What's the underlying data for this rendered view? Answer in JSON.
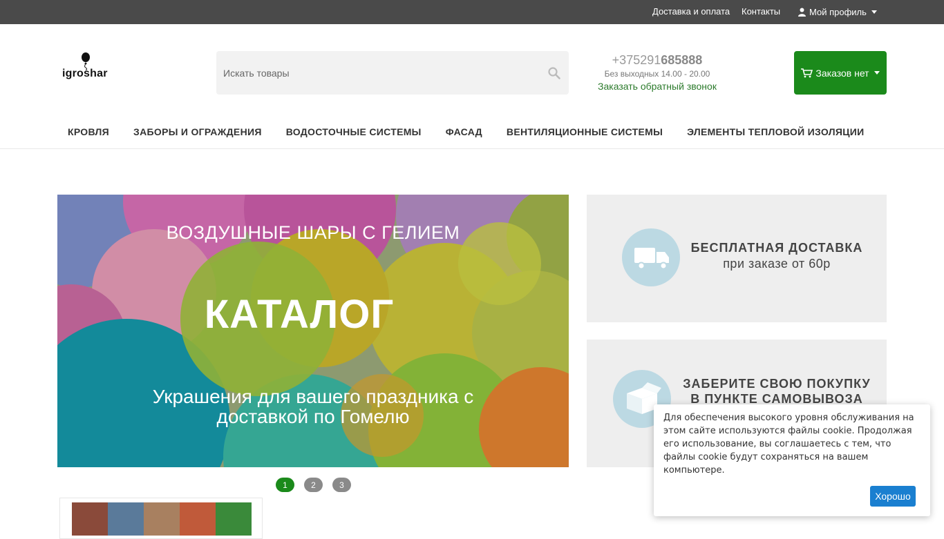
{
  "topbar": {
    "delivery_link": "Доставка и оплата",
    "contacts_link": "Контакты",
    "profile_label": "Мой профиль"
  },
  "logo": {
    "text": "igroshar"
  },
  "search": {
    "placeholder": "Искать товары"
  },
  "phone": {
    "prefix": "+375291",
    "number": "685888",
    "hours": "Без выходных 14.00 - 20.00",
    "callback": "Заказать обратный звонок"
  },
  "cart": {
    "label": "Заказов нет"
  },
  "nav": {
    "items": [
      {
        "label": "КРОВЛЯ"
      },
      {
        "label": "ЗАБОРЫ И ОГРАЖДЕНИЯ"
      },
      {
        "label": "ВОДОСТОЧНЫЕ СИСТЕМЫ"
      },
      {
        "label": "ФАСАД"
      },
      {
        "label": "ВЕНТИЛЯЦИОННЫЕ СИСТЕМЫ"
      },
      {
        "label": "ЭЛЕМЕНТЫ ТЕПЛОВОЙ ИЗОЛЯЦИИ"
      }
    ]
  },
  "slider": {
    "line1": "ВОЗДУШНЫЕ ШАРЫ С ГЕЛИЕМ",
    "line2": "КАТАЛОГ",
    "line3a": "Украшения для вашего праздника с",
    "line3b": "доставкой по Гомелю",
    "dots": [
      "1",
      "2",
      "3"
    ],
    "active_dot": 1
  },
  "promo": {
    "delivery_title": "БЕСПЛАТНАЯ ДОСТАВКА",
    "delivery_sub": "при заказе от 60р",
    "pickup_title1": "ЗАБЕРИТЕ  СВОЮ ПОКУПКУ",
    "pickup_title2": "В ПУНКТЕ САМОВЫВОЗА"
  },
  "cookie": {
    "text": "Для обеспечения высокого уровня обслуживания на этом сайте используются файлы cookie. Продолжая его использование, вы соглашаетесь с тем, что файлы cookie будут сохраняться на вашем компьютере.",
    "button": "Хорошо"
  },
  "colors": {
    "topbar": "#4a4a4a",
    "accent_green": "#1b8a1b",
    "cookie_button": "#1a7fd0",
    "promo_bg": "#eeeeee"
  },
  "icons": [
    "balloon-logo-icon",
    "search-icon",
    "user-icon",
    "cart-icon",
    "truck-icon",
    "box-icon"
  ]
}
